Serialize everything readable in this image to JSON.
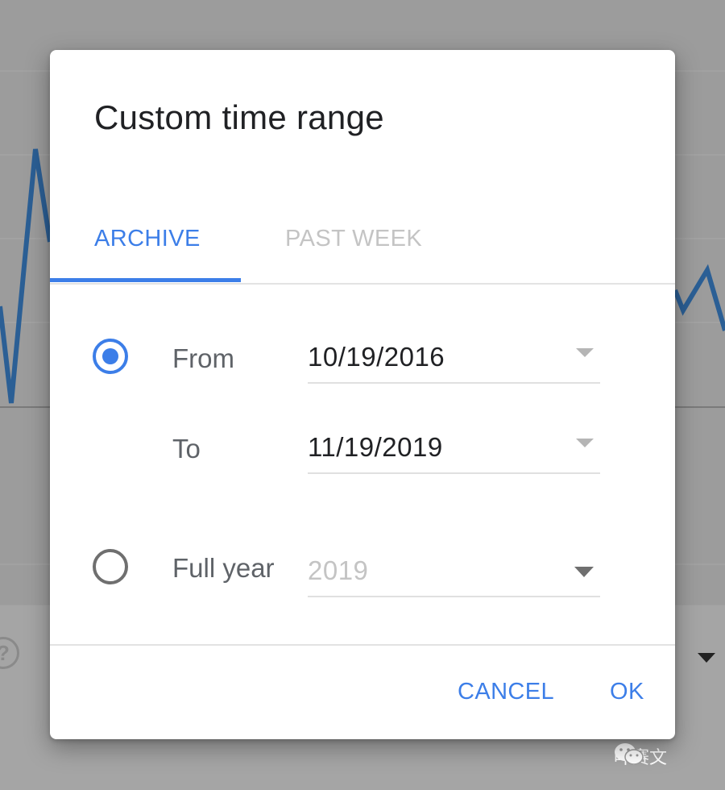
{
  "dialog": {
    "title": "Custom time range",
    "tabs": [
      {
        "label": "ARCHIVE",
        "active": true
      },
      {
        "label": "PAST WEEK",
        "active": false
      }
    ],
    "range_option": {
      "selected": true,
      "from_label": "From",
      "from_value": "10/19/2016",
      "to_label": "To",
      "to_value": "11/19/2019"
    },
    "full_year_option": {
      "selected": false,
      "label": "Full year",
      "value": "2019"
    },
    "buttons": {
      "cancel": "CANCEL",
      "ok": "OK"
    }
  },
  "watermark": {
    "text": "叶赛文",
    "icon": "wechat-icon"
  },
  "background": {
    "help_icon": "help-circle-icon",
    "dropdown_icon": "dropdown-arrow-icon"
  },
  "colors": {
    "accent": "#3c7ee8",
    "backdrop": "#9c9c9c",
    "chart_line": "#2b6cb0",
    "inactive_tab": "#c4c4c4"
  }
}
